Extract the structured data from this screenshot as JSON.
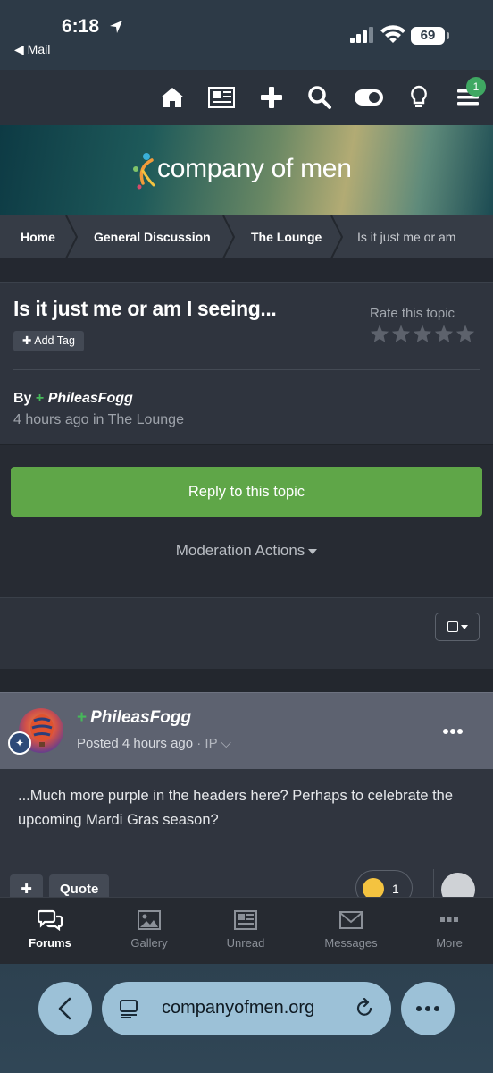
{
  "status_bar": {
    "time": "6:18",
    "back_app": "◀ Mail",
    "battery": "69"
  },
  "top_nav": {
    "icons": [
      "home-icon",
      "newspaper-icon",
      "plus-icon",
      "search-icon",
      "toggle-icon",
      "lightbulb-icon",
      "menu-icon"
    ],
    "notification_count": "1"
  },
  "banner": {
    "logo_text": "company of men"
  },
  "breadcrumb": {
    "items": [
      "Home",
      "General Discussion",
      "The Lounge",
      "Is it just me or am"
    ]
  },
  "topic": {
    "title": "Is it just me or am I seeing...",
    "add_tag": "Add Tag",
    "rate_label": "Rate this topic",
    "rating_stars": 5,
    "by_label": "By",
    "author": "PhileasFogg",
    "meta": "4 hours ago in The Lounge"
  },
  "actions": {
    "reply_button": "Reply to this topic",
    "moderation": "Moderation Actions"
  },
  "post": {
    "author": "PhileasFogg",
    "posted": "Posted 4 hours ago",
    "ip": " · IP ⌵",
    "body": "...Much more purple in the headers here?   Perhaps to celebrate the upcoming Mardi Gras season?",
    "quote_label": "Quote",
    "reaction_count": "1"
  },
  "tabbar": {
    "tabs": [
      {
        "label": "Forums",
        "icon": "chat-bubbles-icon",
        "active": true
      },
      {
        "label": "Gallery",
        "icon": "image-icon",
        "active": false
      },
      {
        "label": "Unread",
        "icon": "newspaper-icon",
        "active": false
      },
      {
        "label": "Messages",
        "icon": "envelope-icon",
        "active": false
      },
      {
        "label": "More",
        "icon": "more-dots-icon",
        "active": false
      }
    ]
  },
  "safari": {
    "url": "companyofmen.org"
  },
  "colors": {
    "reply_green": "#5fa648",
    "plus_green": "#46b85a",
    "badge_green": "#3fa862",
    "safari_pill": "#9cc1d7"
  }
}
